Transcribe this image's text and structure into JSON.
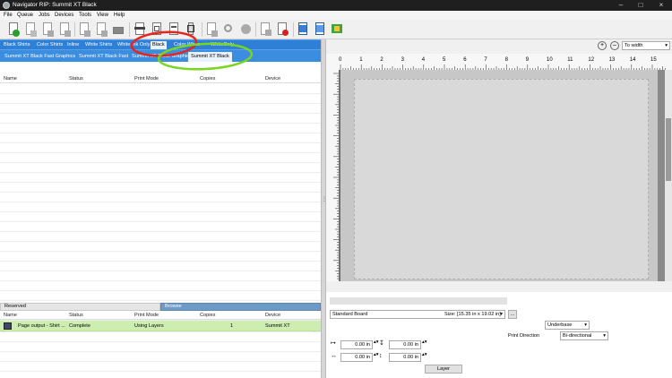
{
  "window": {
    "title": "Navigator RIP: Summit XT Black"
  },
  "menu": [
    "File",
    "Queue",
    "Jobs",
    "Devices",
    "Tools",
    "View",
    "Help"
  ],
  "queue_tabs": [
    {
      "label": "Black Shirts"
    },
    {
      "label": "Color Shirts"
    },
    {
      "label": "Inline"
    },
    {
      "label": "White Shirts"
    },
    {
      "label": "White Ink Only"
    },
    {
      "label": "Black",
      "selected": true
    },
    {
      "label": "Color White"
    },
    {
      "label": "WhiteOnly"
    }
  ],
  "device_tabs": [
    {
      "label": "Summit XT Black Fast Graphics"
    },
    {
      "label": "Summit XT Black Fast"
    },
    {
      "label": "Summit XT Black Graphics"
    },
    {
      "label": "Summit XT Black",
      "selected": true
    }
  ],
  "job_columns": [
    "Name",
    "Status",
    "Print Mode",
    "Copies",
    "Device"
  ],
  "bottom_tabs": [
    "Reserved",
    "Browse"
  ],
  "reserved_columns": [
    "Name",
    "Status",
    "Print Mode",
    "Copies",
    "Device"
  ],
  "reserved_rows": [
    {
      "name": "Page output - Shirt ...",
      "status": "Complete",
      "print_mode": "Using Layers",
      "copies": "1",
      "device": "Summit XT"
    }
  ],
  "preview": {
    "zoom": "To width",
    "ruler_ticks": [
      "0",
      "1",
      "2",
      "3",
      "4",
      "5",
      "6",
      "7",
      "8",
      "9",
      "10",
      "11",
      "12",
      "13",
      "14",
      "15"
    ]
  },
  "settings": {
    "board": "Standard Board",
    "size_label": "Size:",
    "size_value": "[15.35 in x 19.02 in]",
    "browse_button": "...",
    "underbase_option": "Underbase",
    "print_direction_label": "Print Direction",
    "print_direction_value": "Bi-directional",
    "offset_x1": "0.00 in",
    "offset_y1": "0.00 in",
    "offset_x2": "0.00 in",
    "offset_y2": "0.00 in",
    "layer_button": "Layer"
  },
  "colors": {
    "tab_blue": "#2e7fd6",
    "row_highlight": "#cdeeb0",
    "annotation_red": "#e8241c",
    "annotation_green": "#79d51f"
  },
  "toolbar_icons": [
    "add-job-icon",
    "delete-job-icon",
    "move-up-icon",
    "move-down-icon",
    "hold-icon",
    "copy-icon",
    "print-icon",
    "rip-icon",
    "page-layout-icon",
    "page-setup-icon",
    "nest-icon",
    "reprint-icon",
    "zoom-icon",
    "stop-icon",
    "forward-icon",
    "cancel-print-icon",
    "device-settings-icon",
    "queue-settings-icon",
    "printer-status-icon"
  ]
}
